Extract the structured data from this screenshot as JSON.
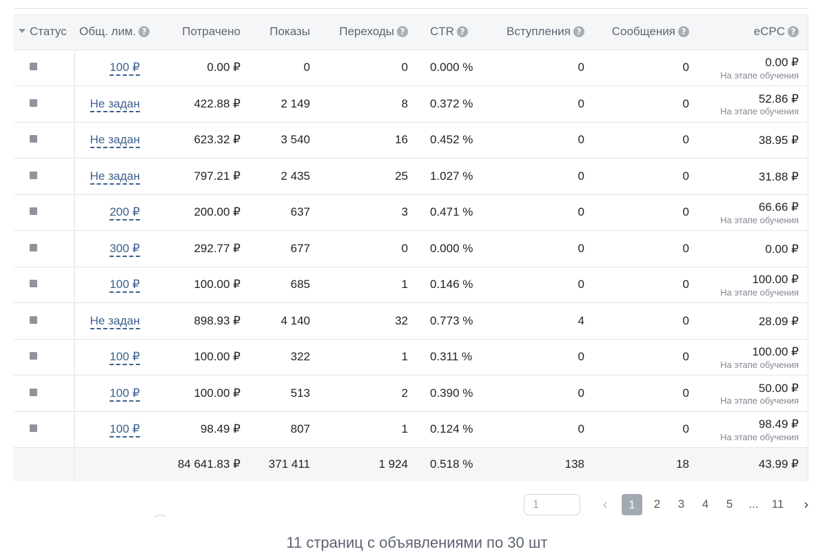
{
  "headers": {
    "status": "Статус",
    "limit": "Общ. лим.",
    "spent": "Потрачено",
    "impressions": "Показы",
    "clicks": "Переходы",
    "ctr": "CTR",
    "joins": "Вступления",
    "messages": "Сообщения",
    "ecpc": "eCPC"
  },
  "rows": [
    {
      "limit": "100 ₽",
      "spent": "0.00 ₽",
      "impressions": "0",
      "clicks": "0",
      "ctr": "0.000 %",
      "joins": "0",
      "messages": "0",
      "ecpc": "0.00 ₽",
      "note": "На этапе обучения"
    },
    {
      "limit": "Не задан",
      "spent": "422.88 ₽",
      "impressions": "2 149",
      "clicks": "8",
      "ctr": "0.372 %",
      "joins": "0",
      "messages": "0",
      "ecpc": "52.86 ₽",
      "note": "На этапе обучения"
    },
    {
      "limit": "Не задан",
      "spent": "623.32 ₽",
      "impressions": "3 540",
      "clicks": "16",
      "ctr": "0.452 %",
      "joins": "0",
      "messages": "0",
      "ecpc": "38.95 ₽",
      "note": ""
    },
    {
      "limit": "Не задан",
      "spent": "797.21 ₽",
      "impressions": "2 435",
      "clicks": "25",
      "ctr": "1.027 %",
      "joins": "0",
      "messages": "0",
      "ecpc": "31.88 ₽",
      "note": ""
    },
    {
      "limit": "200 ₽",
      "spent": "200.00 ₽",
      "impressions": "637",
      "clicks": "3",
      "ctr": "0.471 %",
      "joins": "0",
      "messages": "0",
      "ecpc": "66.66 ₽",
      "note": "На этапе обучения"
    },
    {
      "limit": "300 ₽",
      "spent": "292.77 ₽",
      "impressions": "677",
      "clicks": "0",
      "ctr": "0.000 %",
      "joins": "0",
      "messages": "0",
      "ecpc": "0.00 ₽",
      "note": ""
    },
    {
      "limit": "100 ₽",
      "spent": "100.00 ₽",
      "impressions": "685",
      "clicks": "1",
      "ctr": "0.146 %",
      "joins": "0",
      "messages": "0",
      "ecpc": "100.00 ₽",
      "note": "На этапе обучения"
    },
    {
      "limit": "Не задан",
      "spent": "898.93 ₽",
      "impressions": "4 140",
      "clicks": "32",
      "ctr": "0.773 %",
      "joins": "4",
      "messages": "0",
      "ecpc": "28.09 ₽",
      "note": ""
    },
    {
      "limit": "100 ₽",
      "spent": "100.00 ₽",
      "impressions": "322",
      "clicks": "1",
      "ctr": "0.311 %",
      "joins": "0",
      "messages": "0",
      "ecpc": "100.00 ₽",
      "note": "На этапе обучения"
    },
    {
      "limit": "100 ₽",
      "spent": "100.00 ₽",
      "impressions": "513",
      "clicks": "2",
      "ctr": "0.390 %",
      "joins": "0",
      "messages": "0",
      "ecpc": "50.00 ₽",
      "note": "На этапе обучения"
    },
    {
      "limit": "100 ₽",
      "spent": "98.49 ₽",
      "impressions": "807",
      "clicks": "1",
      "ctr": "0.124 %",
      "joins": "0",
      "messages": "0",
      "ecpc": "98.49 ₽",
      "note": "На этапе обучения"
    }
  ],
  "totals": {
    "spent": "84 641.83 ₽",
    "impressions": "371 411",
    "clicks": "1 924",
    "ctr": "0.518 %",
    "joins": "138",
    "messages": "18",
    "ecpc": "43.99 ₽"
  },
  "pagination": {
    "input_value": "1",
    "pages": [
      "1",
      "2",
      "3",
      "4",
      "5"
    ],
    "active": "1",
    "ellipsis": "...",
    "last": "11"
  },
  "summary": "11 страниц с объявлениями по 30 шт",
  "icons": {
    "help": "question-circle-icon",
    "sort": "sort-desc-icon",
    "status": "status-square-icon",
    "prev": "chevron-left-icon",
    "next": "chevron-right-icon"
  },
  "colors": {
    "link": "#3b5f8e",
    "header_bg": "#f5f6f8",
    "active_page": "#a3a9b3"
  }
}
